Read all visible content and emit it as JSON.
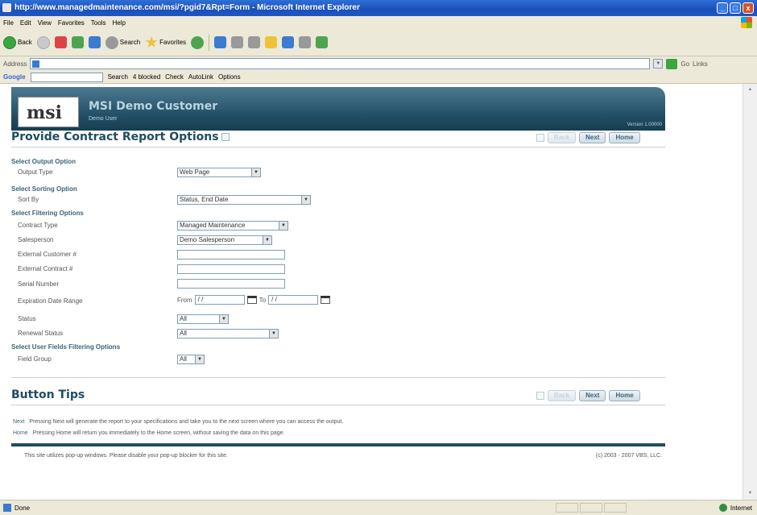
{
  "window": {
    "title": "http://www.managedmaintenance.com/msi/?pgid7&Rpt=Form - Microsoft Internet Explorer",
    "min": "_",
    "max": "□",
    "close": "x"
  },
  "menu": [
    "File",
    "Edit",
    "View",
    "Favorites",
    "Tools",
    "Help"
  ],
  "toolbar": {
    "back": "Back",
    "search": "Search",
    "favorites": "Favorites"
  },
  "address": {
    "label": "Address",
    "go": "Go",
    "links": "Links"
  },
  "googlebar": {
    "logo": "Google",
    "search": "Search",
    "popups": "4 blocked",
    "check": "Check",
    "autolink": "AutoLink",
    "options": "Options"
  },
  "banner": {
    "logo": "msi",
    "company": "MSI Demo Customer",
    "user": "Demo User",
    "version": "Version 1.00000"
  },
  "page": {
    "title": "Provide Contract Report Options"
  },
  "nav": {
    "back": "Back",
    "next": "Next",
    "home": "Home"
  },
  "form": {
    "output_section": "Select Output Option",
    "output_type_label": "Output Type",
    "output_type_value": "Web Page",
    "sort_section": "Select Sorting Option",
    "sort_by_label": "Sort By",
    "sort_by_value": "Status, End Date",
    "filter_section": "Select Filtering Options",
    "contract_type_label": "Contract Type",
    "contract_type_value": "Managed Maintenance",
    "salesperson_label": "Salesperson",
    "salesperson_value": "Demo Salesperson",
    "ext_customer_label": "External Customer #",
    "ext_customer_value": "",
    "ext_contract_label": "External Contract #",
    "ext_contract_value": "",
    "serial_label": "Serial Number",
    "serial_value": "",
    "expiration_label": "Expiration Date Range",
    "from_label": "From",
    "from_value": "/ /",
    "to_label": "To",
    "to_value": "/ /",
    "status_label": "Status",
    "status_value": "All",
    "renewal_label": "Renewal Status",
    "renewal_value": "All",
    "userfields_section": "Select User Fields Filtering Options",
    "field_group_label": "Field Group",
    "field_group_value": "All"
  },
  "tips": {
    "title": "Button Tips",
    "next_key": "Next",
    "next_text": "Pressing Next will generate the report to your specifications and take you to the next screen where you can access the output.",
    "home_key": "Home",
    "home_text": "Pressing Home will return you immediately to the Home screen, without saving the data on this page."
  },
  "footer": {
    "popup_note": "This site utilizes pop-up windows. Please disable your pop-up blocker for this site.",
    "copyright": "(c) 2003 - 2007 VBS, LLC."
  },
  "status": {
    "left": "Done",
    "zone": "Internet"
  }
}
